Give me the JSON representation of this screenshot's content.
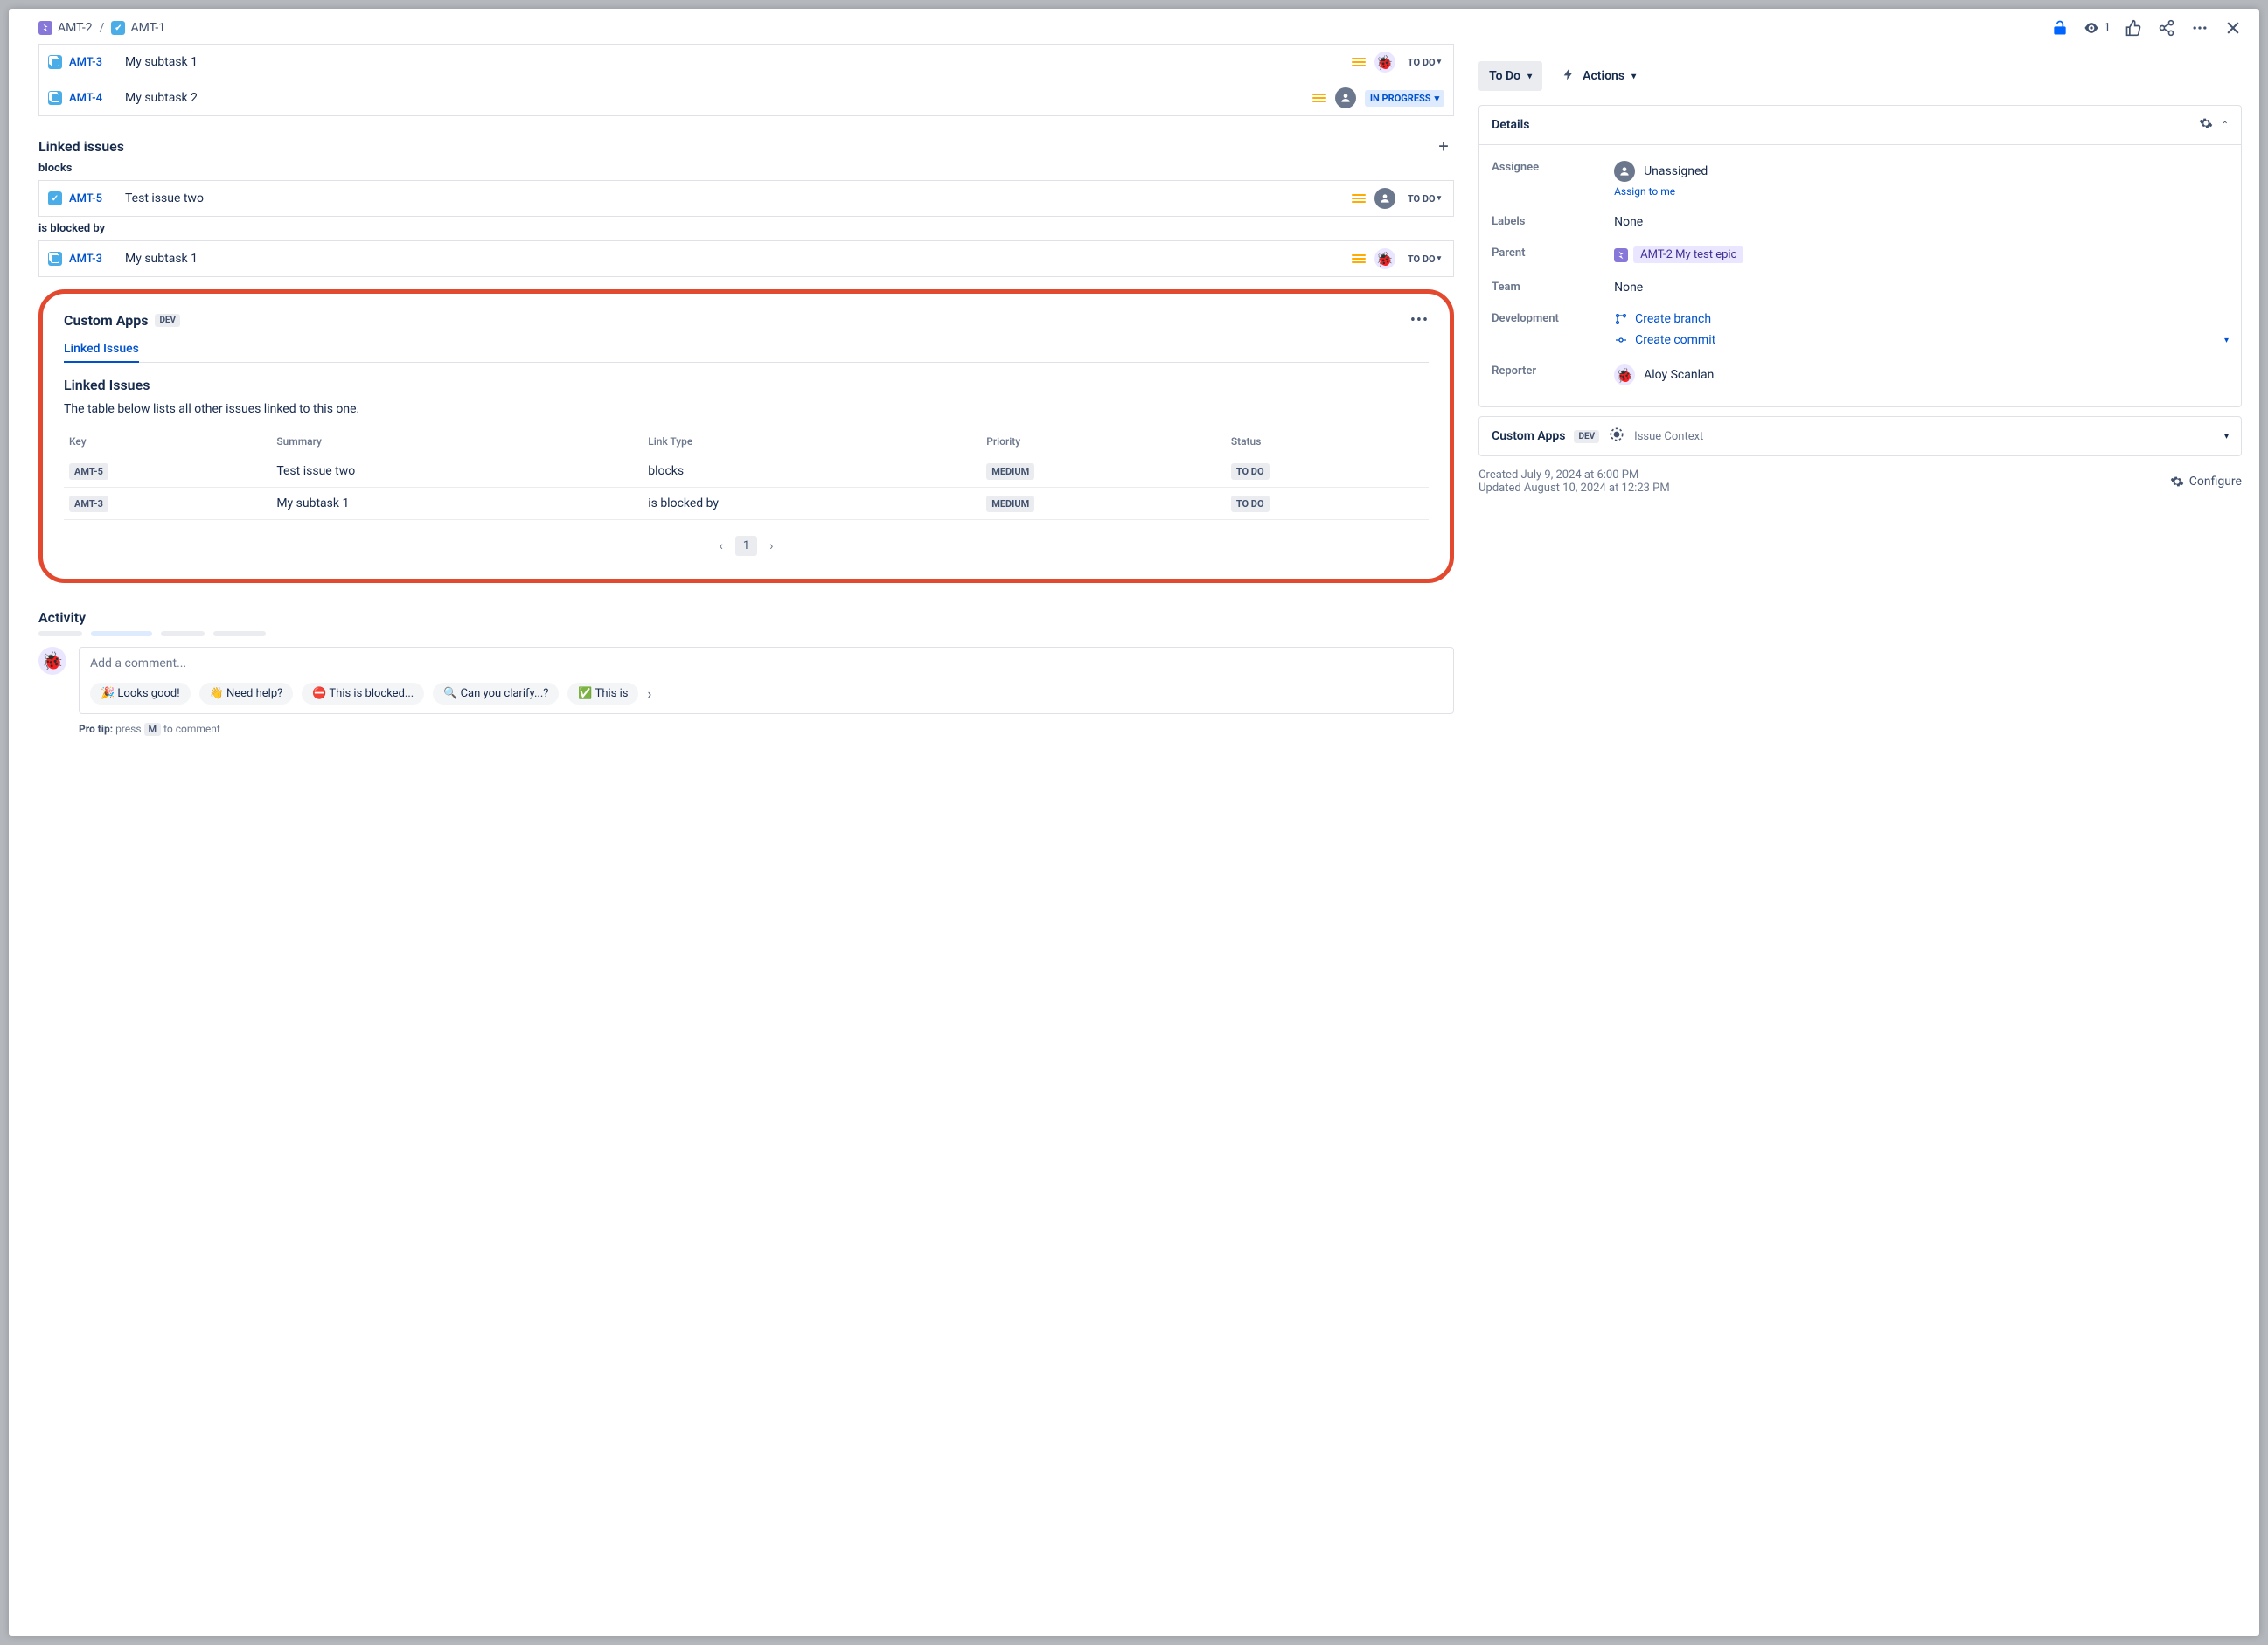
{
  "breadcrumbs": [
    {
      "key": "AMT-2",
      "type": "epic"
    },
    {
      "key": "AMT-1",
      "type": "task"
    }
  ],
  "header": {
    "watchers": "1"
  },
  "subtasks": [
    {
      "key": "AMT-3",
      "summary": "My subtask 1",
      "status": "TO DO",
      "avatar": "bug"
    },
    {
      "key": "AMT-4",
      "summary": "My subtask 2",
      "status": "IN PROGRESS",
      "avatar": "user"
    }
  ],
  "linkedIssues": {
    "title": "Linked issues",
    "groups": [
      {
        "label": "blocks",
        "items": [
          {
            "key": "AMT-5",
            "summary": "Test issue two",
            "status": "TO DO",
            "avatar": "user",
            "type": "task"
          }
        ]
      },
      {
        "label": "is blocked by",
        "items": [
          {
            "key": "AMT-3",
            "summary": "My subtask 1",
            "status": "TO DO",
            "avatar": "bug",
            "type": "subtask"
          }
        ]
      }
    ]
  },
  "customApps": {
    "title": "Custom Apps",
    "badge": "DEV",
    "tab": "Linked Issues",
    "subtitle": "Linked Issues",
    "description": "The table below lists all other issues linked to this one.",
    "columns": [
      "Key",
      "Summary",
      "Link Type",
      "Priority",
      "Status"
    ],
    "rows": [
      {
        "key": "AMT-5",
        "summary": "Test issue two",
        "linkType": "blocks",
        "priority": "MEDIUM",
        "status": "TO DO"
      },
      {
        "key": "AMT-3",
        "summary": "My subtask 1",
        "linkType": "is blocked by",
        "priority": "MEDIUM",
        "status": "TO DO"
      }
    ],
    "page": "1"
  },
  "activity": {
    "title": "Activity",
    "commentPlaceholder": "Add a comment...",
    "quick": [
      "🎉 Looks good!",
      "👋 Need help?",
      "⛔ This is blocked...",
      "🔍 Can you clarify...?",
      "✅ This is"
    ],
    "protipLabel": "Pro tip:",
    "protipPress": "press",
    "protipKey": "M",
    "protipRest": "to comment"
  },
  "side": {
    "statusBtn": "To Do",
    "actionsBtn": "Actions",
    "details": {
      "title": "Details",
      "assigneeLabel": "Assignee",
      "assigneeValue": "Unassigned",
      "assignToMe": "Assign to me",
      "labelsLabel": "Labels",
      "labelsValue": "None",
      "parentLabel": "Parent",
      "parentValue": "AMT-2 My test epic",
      "teamLabel": "Team",
      "teamValue": "None",
      "devLabel": "Development",
      "createBranch": "Create branch",
      "createCommit": "Create commit",
      "reporterLabel": "Reporter",
      "reporterValue": "Aloy Scanlan"
    },
    "context": {
      "title": "Custom Apps",
      "badge": "DEV",
      "text": "Issue Context"
    },
    "created": "Created July 9, 2024 at 6:00 PM",
    "updated": "Updated August 10, 2024 at 12:23 PM",
    "configure": "Configure"
  }
}
